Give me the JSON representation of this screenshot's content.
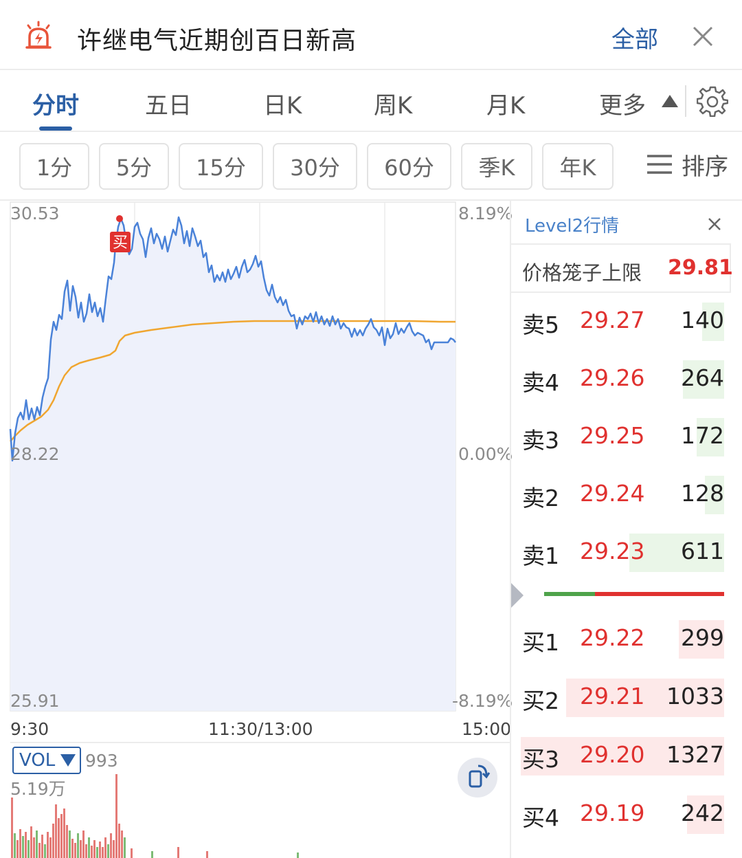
{
  "header": {
    "title": "许继电气近期创百日新高",
    "all_label": "全部",
    "icon": "alarm-icon"
  },
  "tabs": [
    {
      "label": "分时",
      "active": true
    },
    {
      "label": "五日"
    },
    {
      "label": "日K"
    },
    {
      "label": "周K"
    },
    {
      "label": "月K"
    },
    {
      "label": "更多"
    }
  ],
  "subtabs": [
    "1分",
    "5分",
    "15分",
    "30分",
    "60分",
    "季K",
    "年K"
  ],
  "sort_label": "排序",
  "chart": {
    "y_top": "30.53",
    "y_mid": "28.22",
    "y_bot": "25.91",
    "pct_top": "8.19%",
    "pct_mid": "0.00%",
    "pct_bot": "-8.19%",
    "time_start": "9:30",
    "time_mid": "11:30/13:00",
    "time_end": "15:00",
    "buy_marker": "买",
    "colors": {
      "price": "#4a82d8",
      "avg": "#f0a630",
      "fill": "#eef1fb"
    }
  },
  "volume": {
    "label": "VOL",
    "current": "993",
    "max": "5.19万"
  },
  "level2": {
    "title": "Level2行情",
    "cage_label": "价格笼子上限",
    "cage_value": "29.81",
    "sells": [
      {
        "name": "卖5",
        "price": "29.27",
        "vol": "140"
      },
      {
        "name": "卖4",
        "price": "29.26",
        "vol": "264"
      },
      {
        "name": "卖3",
        "price": "29.25",
        "vol": "172"
      },
      {
        "name": "卖2",
        "price": "29.24",
        "vol": "128"
      },
      {
        "name": "卖1",
        "price": "29.23",
        "vol": "611"
      }
    ],
    "buys": [
      {
        "name": "买1",
        "price": "29.22",
        "vol": "299"
      },
      {
        "name": "买2",
        "price": "29.21",
        "vol": "1033"
      },
      {
        "name": "买3",
        "price": "29.20",
        "vol": "1327"
      },
      {
        "name": "买4",
        "price": "29.19",
        "vol": "242"
      }
    ]
  }
}
